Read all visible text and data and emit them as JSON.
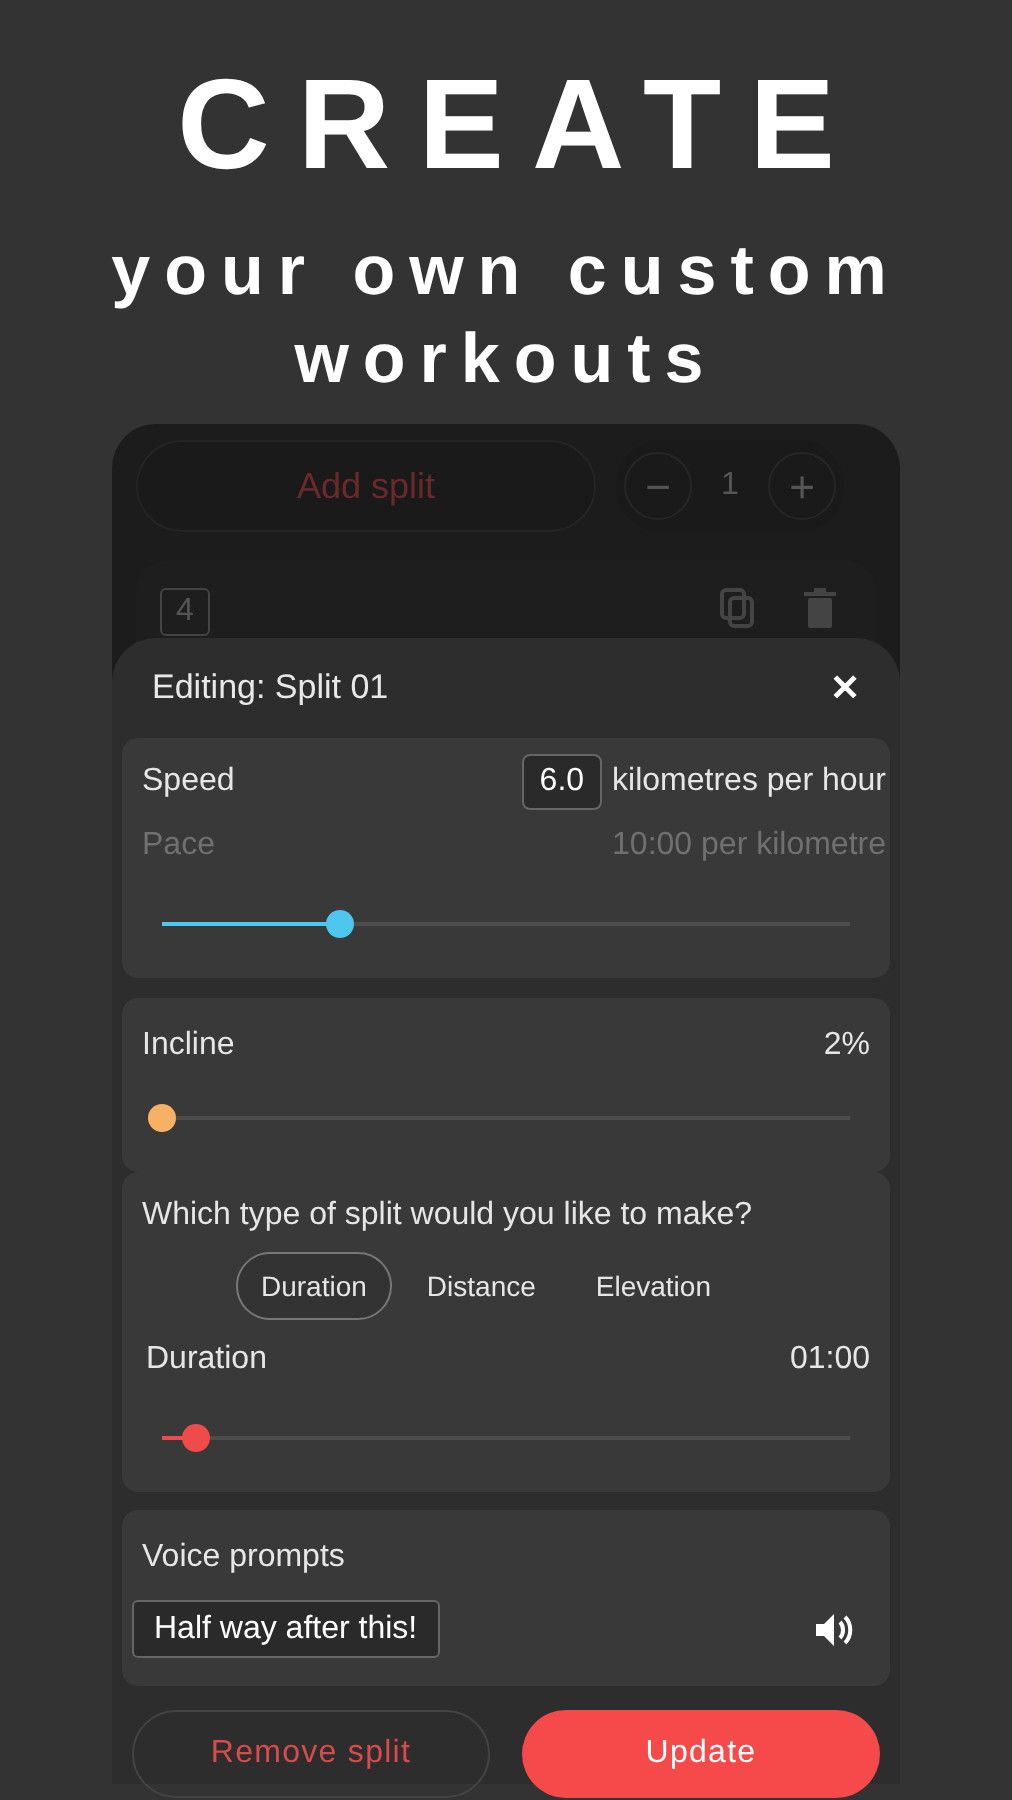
{
  "headline": "CREATE",
  "subheadline": "your own custom workouts",
  "background_screen": {
    "add_button": "Add split",
    "stepper": {
      "minus": "−",
      "value": "1",
      "plus": "+"
    },
    "split_number": "4"
  },
  "sheet": {
    "title": "Editing: Split 01",
    "close": "✕",
    "speed": {
      "label": "Speed",
      "value": "6.0",
      "unit": "kilometres per hour",
      "pace_label": "Pace",
      "pace_value": "10:00 per kilometre",
      "level": 0.26
    },
    "incline": {
      "label": "Incline",
      "value": "2%",
      "level": 0
    },
    "split_type": {
      "question": "Which type of split would you like to make?",
      "options": [
        {
          "label": "Duration",
          "selected": true
        },
        {
          "label": "Distance",
          "selected": false
        },
        {
          "label": "Elevation",
          "selected": false
        }
      ],
      "label": "Duration",
      "value": "01:00",
      "level": 0.05
    },
    "voice_prompts": {
      "label": "Voice prompts",
      "value": "Half way after this!"
    },
    "buttons": {
      "remove": "Remove split",
      "update": "Update"
    }
  }
}
